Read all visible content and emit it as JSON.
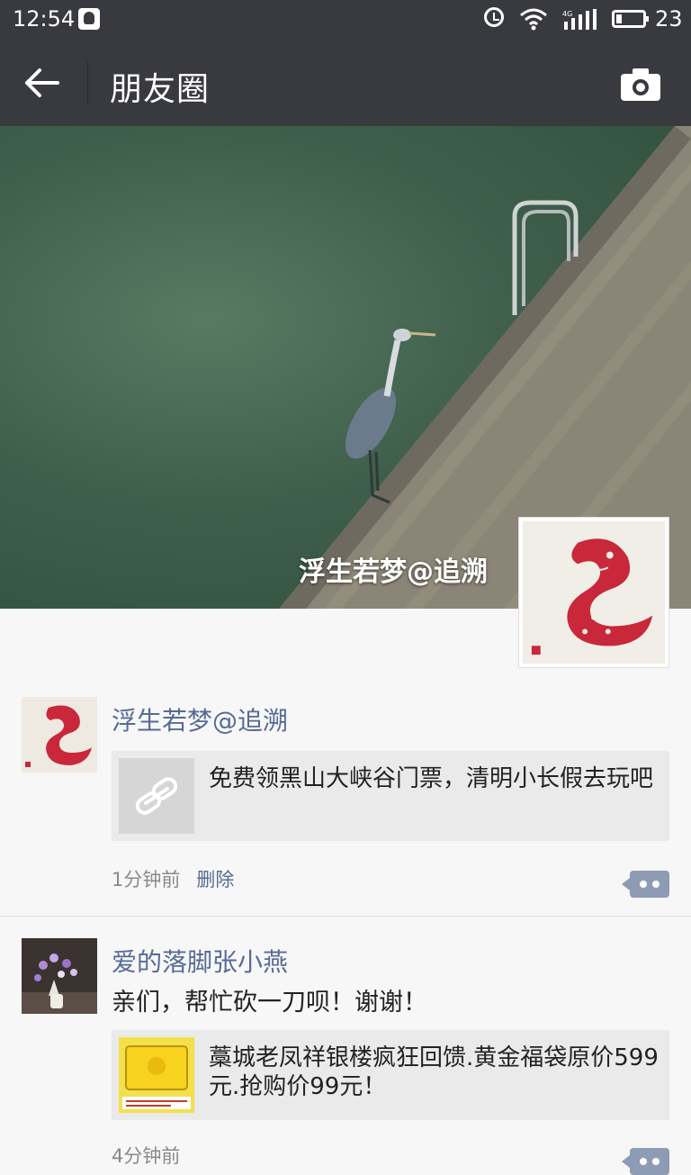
{
  "status_bar": {
    "time": "12:54",
    "network": "4G",
    "battery": "23"
  },
  "header": {
    "title": "朋友圈",
    "back_icon": "arrow-left-icon",
    "camera_icon": "camera-icon"
  },
  "cover": {
    "user_name": "浮生若梦@追溯"
  },
  "posts": [
    {
      "name": "浮生若梦@追溯",
      "text": "",
      "link": {
        "thumb_icon": "link-icon",
        "title": "免费领黑山大峡谷门票，清明小长假去玩吧"
      },
      "time": "1分钟前",
      "delete_label": "删除"
    },
    {
      "name": "爱的落脚张小燕",
      "text": "亲们，帮忙砍一刀呗！谢谢！",
      "link": {
        "title": "藁城老凤祥银楼疯狂回馈.黄金福袋原价599元.抢购价99元！"
      },
      "time": "4分钟前"
    }
  ],
  "colors": {
    "bar_bg": "#393a3f",
    "link_name": "#576b95",
    "card_bg": "#eaeaea"
  }
}
